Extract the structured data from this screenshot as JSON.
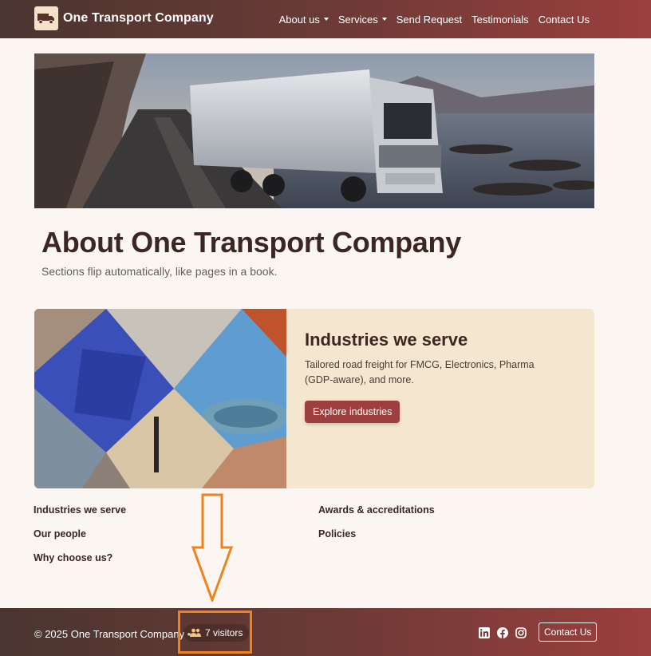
{
  "brand": {
    "title": "One Transport Company",
    "logo_icon": "truck-icon"
  },
  "nav": {
    "items": [
      {
        "label": "About us",
        "dropdown": true
      },
      {
        "label": "Services",
        "dropdown": true
      },
      {
        "label": "Send Request",
        "dropdown": false
      },
      {
        "label": "Testimonials",
        "dropdown": false
      },
      {
        "label": "Contact Us",
        "dropdown": false
      }
    ]
  },
  "page": {
    "title": "About One Transport Company",
    "subtitle": "Sections flip automatically, like pages in a book."
  },
  "card": {
    "title": "Industries we serve",
    "text": "Tailored road freight for FMCG, Electronics, Pharma (GDP-aware), and more.",
    "button": "Explore industries"
  },
  "sections": {
    "left": [
      "Industries we serve",
      "Our people",
      "Why choose us?"
    ],
    "right": [
      "Awards & accreditations",
      "Policies"
    ]
  },
  "footer": {
    "copyright": "© 2025 One Transport Company •",
    "visitors": "7 visitors",
    "visitor_icon": "users-icon",
    "social": [
      "linkedin-icon",
      "facebook-icon",
      "instagram-icon"
    ],
    "contact": "Contact Us"
  },
  "colors": {
    "header_start": "#4a3530",
    "header_end": "#9b3f3d",
    "accent": "#9e3f3f",
    "card_bg": "#f5e6cf",
    "annotation": "#f0821e"
  }
}
